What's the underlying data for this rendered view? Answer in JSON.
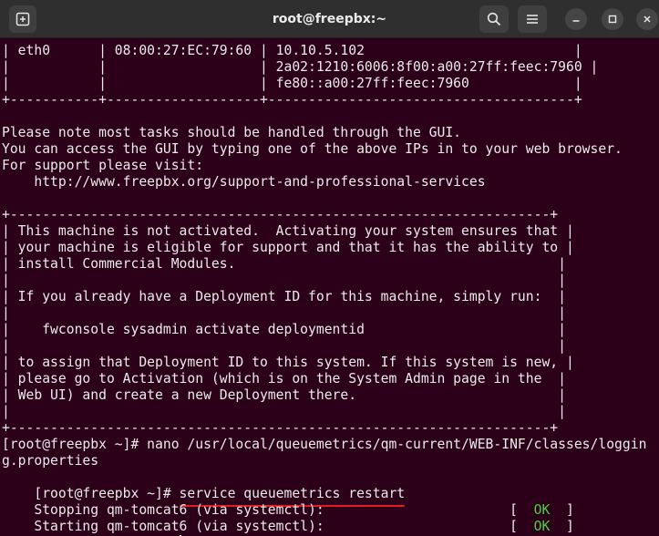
{
  "window": {
    "title": "root@freepbx:~"
  },
  "colors": {
    "terminal_background": "#2c0018",
    "terminal_text": "#ebebeb",
    "ok_status": "#4ed03c",
    "annotation_underline": "#e01b24",
    "titlebar_background": "#2f2f2f"
  },
  "icons": {
    "new_tab": "new-tab-icon",
    "search": "search-icon",
    "menu": "hamburger-menu-icon",
    "minimize": "minimize-icon",
    "maximize": "maximize-icon",
    "close": "close-icon"
  },
  "terminal": {
    "net_rows": [
      "| eth0      | 08:00:27:EC:79:60 | 10.10.5.102                          |",
      "|           |                   | 2a02:1210:6006:8f00:a00:27ff:feec:7960 |",
      "|           |                   | fe80::a00:27ff:feec:7960             |",
      "+-----------+-------------------+--------------------------------------+"
    ],
    "notice": [
      "Please note most tasks should be handled through the GUI.",
      "You can access the GUI by typing one of the above IPs in to your web browser.",
      "For support please visit:",
      "    http://www.freepbx.org/support-and-professional-services"
    ],
    "activation_box": [
      "+-------------------------------------------------------------------+",
      "| This machine is not activated.  Activating your system ensures that |",
      "| your machine is eligible for support and that it has the ability to |",
      "| install Commercial Modules.                                        |",
      "|                                                                    |",
      "| If you already have a Deployment ID for this machine, simply run:  |",
      "|                                                                    |",
      "|    fwconsole sysadmin activate deploymentid                        |",
      "|                                                                    |",
      "| to assign that Deployment ID to this system. If this system is new, |",
      "| please go to Activation (which is on the System Admin page in the  |",
      "| Web UI) and create a new Deployment there.                         |",
      "|                                                                    |",
      "+-------------------------------------------------------------------+"
    ],
    "prompt": "[root@freepbx ~]# ",
    "cmd1_line1": "[root@freepbx ~]# nano /usr/local/queuemetrics/qm-current/WEB-INF/classes/loggin",
    "cmd1_line2": "g.properties",
    "cmd2": "service queuemetrics restart",
    "stopping_label": "Stopping qm-tomcat6 (via systemctl):                       [  ",
    "starting_label": "Starting qm-tomcat6 (via systemctl):                       [  ",
    "ok_text": "OK",
    "bracket_close": "  ]"
  }
}
